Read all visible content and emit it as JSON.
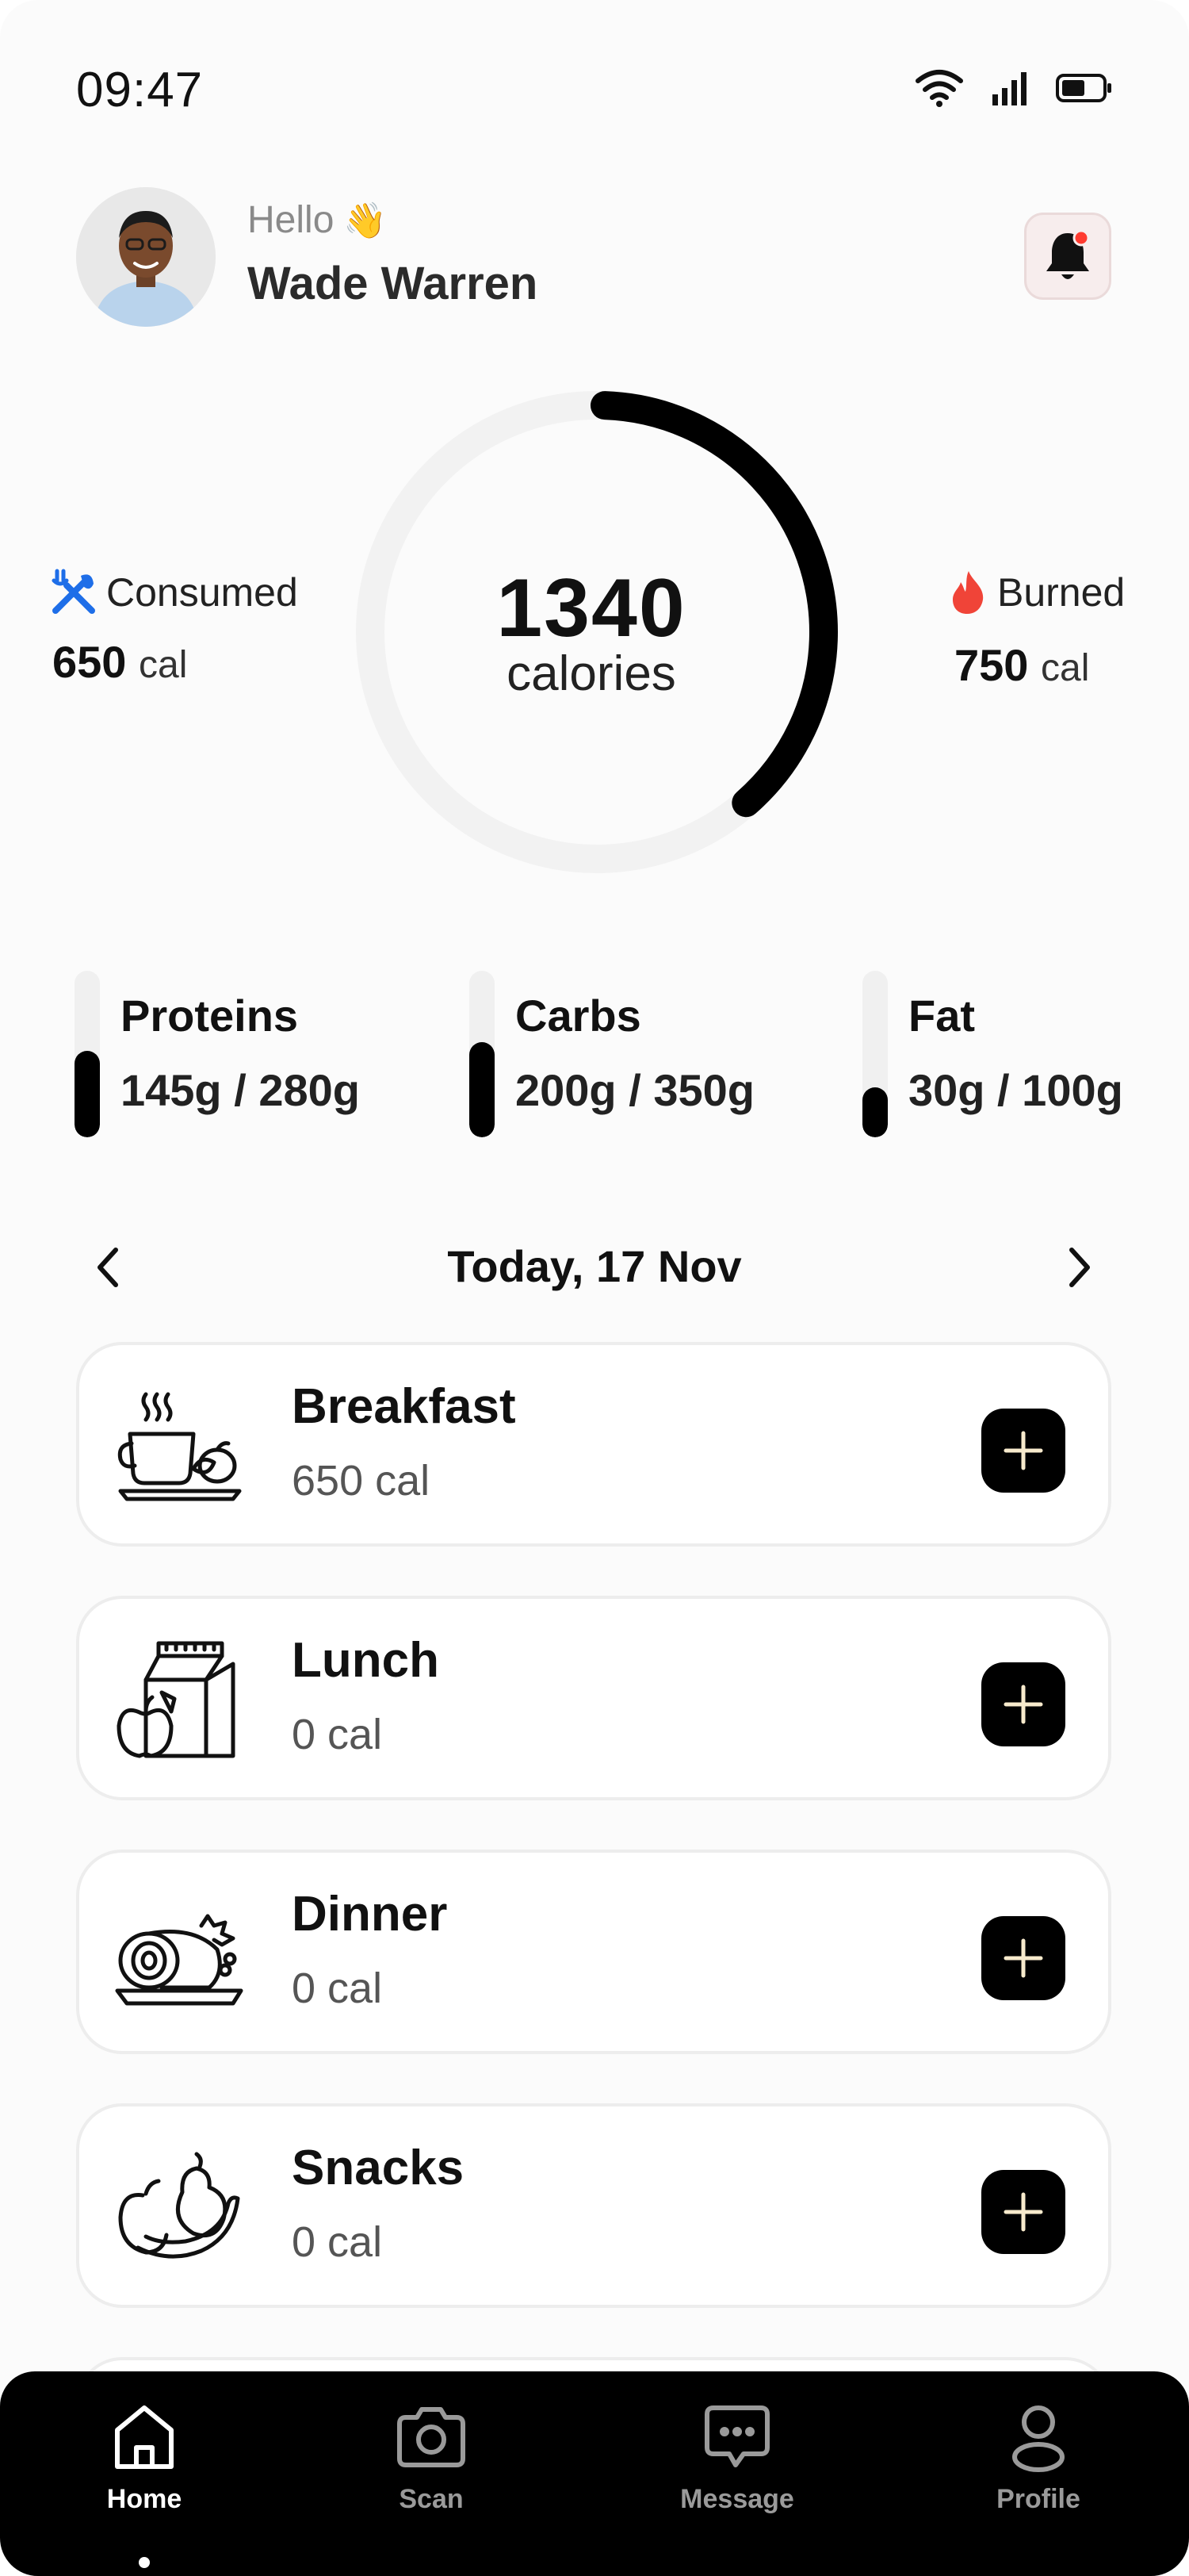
{
  "status_bar": {
    "time": "09:47"
  },
  "header": {
    "greeting": "Hello",
    "wave_emoji": "👋",
    "user_name": "Wade Warren",
    "notification_badge_color": "#ff3b30"
  },
  "calories": {
    "total": "1340",
    "unit_label": "calories",
    "ring_progress": 0.38,
    "consumed": {
      "label": "Consumed",
      "value": "650",
      "unit": "cal",
      "icon": "fork-knife-icon",
      "icon_color": "#1e6ee8"
    },
    "burned": {
      "label": "Burned",
      "value": "750",
      "unit": "cal",
      "icon": "flame-icon",
      "icon_color": "#f04438"
    }
  },
  "macros": [
    {
      "name": "Proteins",
      "amount": "145g / 280g",
      "progress": 0.52
    },
    {
      "name": "Carbs",
      "amount": "200g / 350g",
      "progress": 0.57
    },
    {
      "name": "Fat",
      "amount": "30g / 100g",
      "progress": 0.3
    }
  ],
  "date_nav": {
    "label": "Today, 17 Nov"
  },
  "meals": [
    {
      "name": "Breakfast",
      "calories": "650 cal",
      "icon": "breakfast-icon"
    },
    {
      "name": "Lunch",
      "calories": "0 cal",
      "icon": "lunch-icon"
    },
    {
      "name": "Dinner",
      "calories": "0 cal",
      "icon": "dinner-icon"
    },
    {
      "name": "Snacks",
      "calories": "0 cal",
      "icon": "snacks-icon"
    }
  ],
  "bottom_nav": [
    {
      "label": "Home",
      "icon": "home-icon",
      "active": true
    },
    {
      "label": "Scan",
      "icon": "camera-icon",
      "active": false
    },
    {
      "label": "Message",
      "icon": "message-icon",
      "active": false
    },
    {
      "label": "Profile",
      "icon": "profile-icon",
      "active": false
    }
  ]
}
